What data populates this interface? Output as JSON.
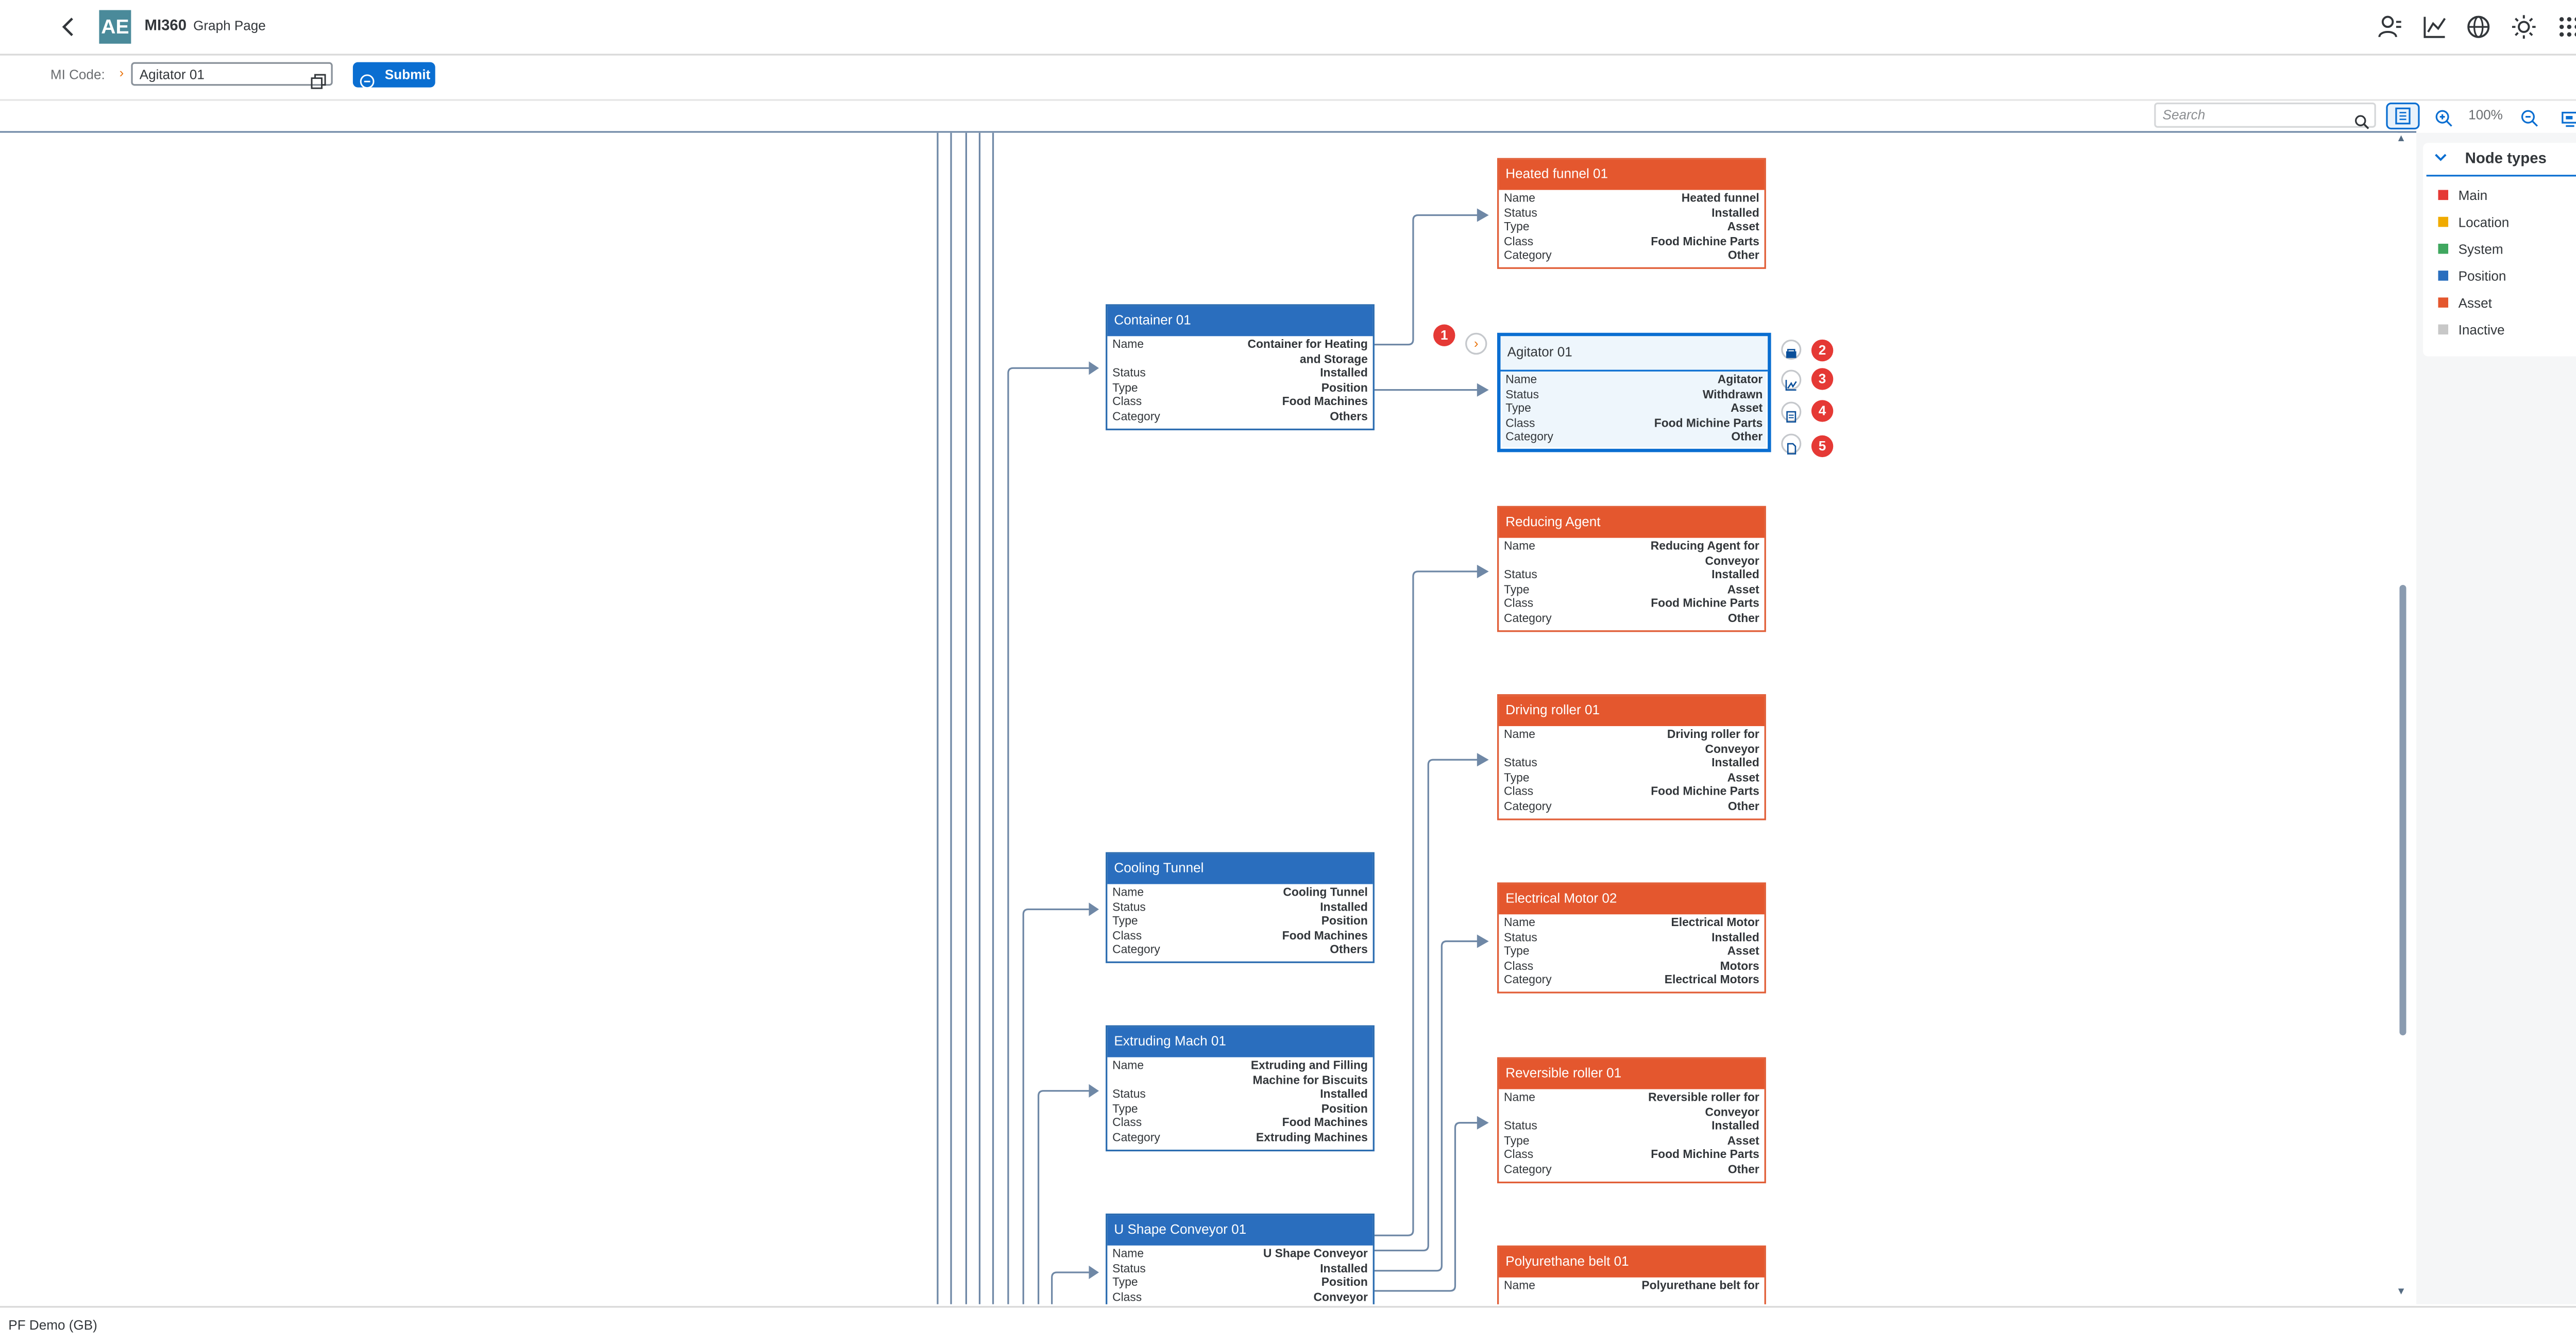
{
  "shell": {
    "logo_text": "AE",
    "app_title": "MI360",
    "page_title": "Graph Page",
    "icons": [
      "back-icon",
      "user-settings-icon",
      "analytics-icon",
      "globe-icon",
      "theme-icon",
      "app-grid-icon"
    ]
  },
  "subheader": {
    "mi_code_label": "MI Code:",
    "mi_code_value": "Agitator 01",
    "submit_label": "Submit"
  },
  "toolbar": {
    "search_placeholder": "Search",
    "zoom_level": "100%"
  },
  "nodes": {
    "heated_funnel": {
      "title": "Heated funnel 01",
      "name": "Heated funnel",
      "status": "Installed",
      "type": "Asset",
      "class": "Food Michine Parts",
      "category": "Other"
    },
    "container": {
      "title": "Container 01",
      "name": "Container for Heating and Storage",
      "status": "Installed",
      "type": "Position",
      "class": "Food Machines",
      "category": "Others"
    },
    "agitator": {
      "title": "Agitator 01",
      "name": "Agitator",
      "status": "Withdrawn",
      "type": "Asset",
      "class": "Food Michine Parts",
      "category": "Other"
    },
    "reducing_agent": {
      "title": "Reducing Agent",
      "name": "Reducing Agent for Conveyor",
      "status": "Installed",
      "type": "Asset",
      "class": "Food Michine Parts",
      "category": "Other"
    },
    "driving_roller": {
      "title": "Driving roller 01",
      "name": "Driving roller for Conveyor",
      "status": "Installed",
      "type": "Asset",
      "class": "Food Michine Parts",
      "category": "Other"
    },
    "cooling_tunnel": {
      "title": "Cooling Tunnel",
      "name": "Cooling Tunnel",
      "status": "Installed",
      "type": "Position",
      "class": "Food Machines",
      "category": "Others"
    },
    "electrical_motor": {
      "title": "Electrical Motor 02",
      "name": "Electrical Motor",
      "status": "Installed",
      "type": "Asset",
      "class": "Motors",
      "category": "Electrical Motors"
    },
    "extruding": {
      "title": "Extruding Mach 01",
      "name": "Extruding and Filling Machine for Biscuits",
      "status": "Installed",
      "type": "Position",
      "class": "Food Machines",
      "category": "Extruding Machines"
    },
    "reversible_roller": {
      "title": "Reversible roller 01",
      "name": "Reversible roller for Conveyor",
      "status": "Installed",
      "type": "Asset",
      "class": "Food Michine Parts",
      "category": "Other"
    },
    "u_shape": {
      "title": "U Shape Conveyor 01",
      "name": "U Shape Conveyor",
      "status": "Installed",
      "type": "Position",
      "class": "Conveyor"
    },
    "polyurethane": {
      "title": "Polyurethane belt 01",
      "name": "Polyurethane belt for"
    }
  },
  "labels": {
    "name": "Name",
    "status": "Status",
    "type": "Type",
    "class": "Class",
    "category": "Category"
  },
  "callouts": [
    "1",
    "2",
    "3",
    "4",
    "5"
  ],
  "legend": {
    "title": "Node types",
    "items": [
      {
        "label": "Main",
        "color": "#e53935"
      },
      {
        "label": "Location",
        "color": "#f0ab00"
      },
      {
        "label": "System",
        "color": "#3fa75f"
      },
      {
        "label": "Position",
        "color": "#2a6ebe"
      },
      {
        "label": "Asset",
        "color": "#e4572e"
      },
      {
        "label": "Inactive",
        "color": "#c8c8c8"
      }
    ]
  },
  "footer": {
    "system_label": "PF Demo (GB)"
  }
}
